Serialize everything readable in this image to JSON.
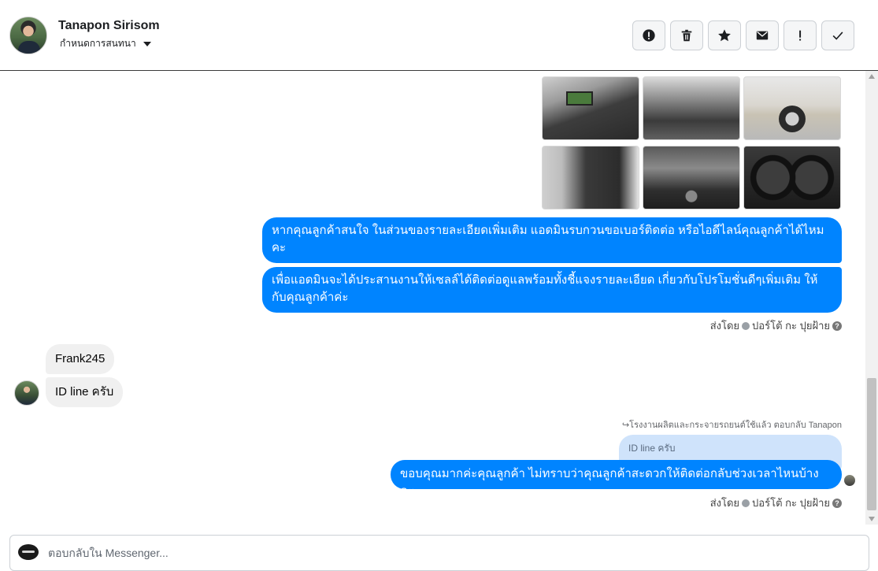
{
  "header": {
    "contact_name": "Tanapon Sirisom",
    "assign_label": "กำหนดการสนทนา",
    "actions": [
      {
        "icon": "alert-circle-icon"
      },
      {
        "icon": "trash-icon"
      },
      {
        "icon": "star-icon"
      },
      {
        "icon": "envelope-icon"
      },
      {
        "icon": "exclamation-icon",
        "text": "!"
      },
      {
        "icon": "check-icon"
      }
    ]
  },
  "messages": {
    "outgoing_1": "หากคุณลูกค้าสนใจ ในส่วนของรายละเอียดเพิ่มเติม แอดมินรบกวนขอเบอร์ติดต่อ หรือไอดีไลน์คุณลูกค้าได้ไหมคะ",
    "outgoing_2": "เพื่อแอดมินจะได้ประสานงานให้เซลล์ได้ติดต่อดูแลพร้อมทั้งชี้แจงรายละเอียด เกี่ยวกับโปรโมชั่นดีๆเพิ่มเติม ให้กับคุณลูกค้าค่ะ",
    "sent_by_1": "ส่งโดย",
    "sender_1": "ปอร์โต้ กะ ปุยฝ้าย",
    "incoming_1": "Frank245",
    "incoming_2": "ID line ครับ",
    "reply_note": "โรงงานผลิตและกระจายรถยนต์ใช้แล้ว ตอบกลับ Tanapon",
    "quoted_text": "ID line ครับ",
    "outgoing_3": "ขอบคุณมากค่ะคุณลูกค้า ไม่ทราบว่าคุณลูกค้าสะดวกให้ติดต่อกลับช่วงเวลาไหนบ้างคะ",
    "sent_by_2": "ส่งโดย",
    "sender_2": "ปอร์โต้ กะ ปุยฝ้าย",
    "help_glyph": "?"
  },
  "photos": [
    "dashboard",
    "interior-seats",
    "front-wheel",
    "door-panel",
    "engine-bay",
    "gauge-cluster"
  ],
  "composer": {
    "placeholder": "ตอบกลับใน Messenger..."
  },
  "colors": {
    "outgoing_bubble": "#0084ff",
    "incoming_bubble": "#f0f0f0",
    "quote_bubble": "#cfe3fb"
  }
}
